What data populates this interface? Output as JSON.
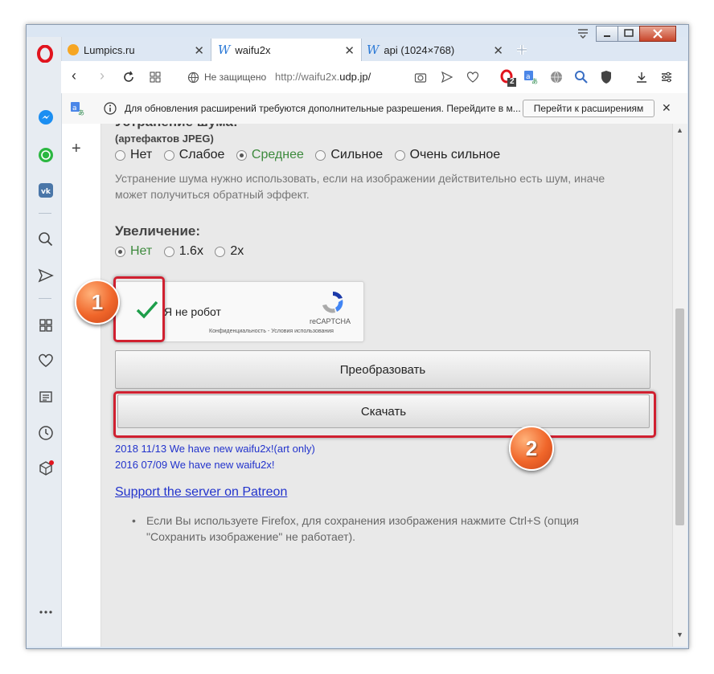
{
  "tabs": [
    {
      "label": "Lumpics.ru",
      "favicon": "lumpics-orange-icon"
    },
    {
      "label": "waifu2x",
      "favicon": "waifu-w-icon"
    },
    {
      "label": "api (1024×768)",
      "favicon": "waifu-w-icon"
    }
  ],
  "address": {
    "security_label": "Не защищено",
    "url_prefix": "http://waifu2x.",
    "url_host": "udp.jp/"
  },
  "extension_badge": "2",
  "infobar": {
    "message": "Для обновления расширений требуются дополнительные разрешения. Перейдите в м...",
    "button_label": "Перейти к расширениям"
  },
  "noise": {
    "heading_partial": "Устранение шума:",
    "subheading": "(артефактов JPEG)",
    "options": [
      "Нет",
      "Слабое",
      "Среднее",
      "Сильное",
      "Очень сильное"
    ],
    "selected": "Среднее",
    "hint": "Устранение шума нужно использовать, если на изображении действительно есть шум, иначе может получиться обратный эффект."
  },
  "scale": {
    "heading": "Увеличение:",
    "options": [
      "Нет",
      "1.6x",
      "2x"
    ],
    "selected": "Нет"
  },
  "recaptcha": {
    "label": "Я не робот",
    "brand": "reCAPTCHA",
    "footer": "Конфиденциальность - Условия использования"
  },
  "buttons": {
    "convert": "Преобразовать",
    "download": "Скачать"
  },
  "news": [
    "2018 11/13 We have new waifu2x!(art only)",
    "2016 07/09 We have new waifu2x!"
  ],
  "patreon_link": "Support the server on Patreon",
  "note": "Если Вы используете Firefox, для сохранения изображения нажмите Ctrl+S (опция \"Сохранить изображение\" не работает).",
  "badges": [
    "1",
    "2"
  ],
  "colors": {
    "accent_red": "#d02030",
    "selected_green": "#3d8a3d",
    "link_blue": "#2233cc",
    "badge_orange": "#f0662a"
  }
}
